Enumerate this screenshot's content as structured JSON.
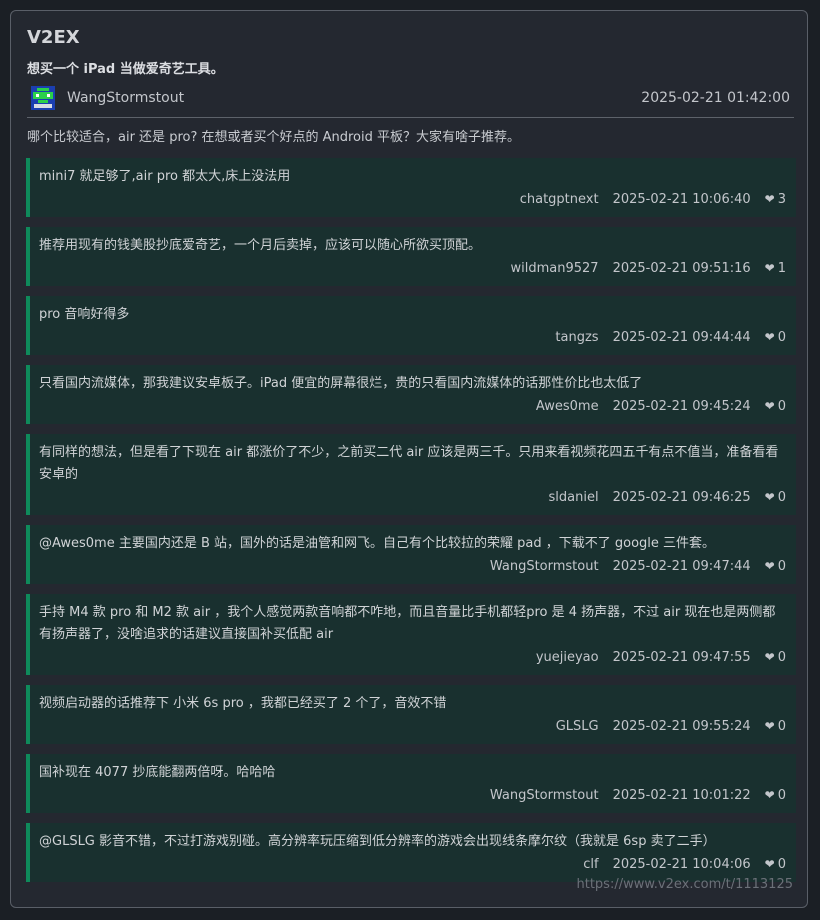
{
  "site": {
    "title": "V2EX"
  },
  "topic": {
    "title": "想买一个 iPad 当做爱奇艺工具。",
    "author": "WangStormstout",
    "time": "2025-02-21 01:42:00",
    "body": "哪个比较适合，air 还是 pro? 在想或者买个好点的 Android 平板？大家有啥子推荐。"
  },
  "replies": [
    {
      "text": "mini7 就足够了,air pro 都太大,床上没法用",
      "user": "chatgptnext",
      "time": "2025-02-21 10:06:40",
      "likes": "3"
    },
    {
      "text": "推荐用现有的钱美股抄底爱奇艺，一个月后卖掉，应该可以随心所欲买顶配。",
      "user": "wildman9527",
      "time": "2025-02-21 09:51:16",
      "likes": "1"
    },
    {
      "text": "pro 音响好得多",
      "user": "tangzs",
      "time": "2025-02-21 09:44:44",
      "likes": "0"
    },
    {
      "text": "只看国内流媒体，那我建议安卓板子。iPad 便宜的屏幕很烂，贵的只看国内流媒体的话那性价比也太低了",
      "user": "Awes0me",
      "time": "2025-02-21 09:45:24",
      "likes": "0"
    },
    {
      "text": "有同样的想法，但是看了下现在 air 都涨价了不少，之前买二代 air 应该是两三千。只用来看视频花四五千有点不值当，准备看看安卓的",
      "user": "sldaniel",
      "time": "2025-02-21 09:46:25",
      "likes": "0"
    },
    {
      "text": "@Awes0me 主要国内还是 B 站，国外的话是油管和网飞。自己有个比较拉的荣耀 pad ，下载不了 google 三件套。",
      "user": "WangStormstout",
      "time": "2025-02-21 09:47:44",
      "likes": "0"
    },
    {
      "text": "手持 M4 款 pro 和 M2 款 air ，我个人感觉两款音响都不咋地，而且音量比手机都轻pro 是 4 扬声器，不过 air 现在也是两侧都有扬声器了，没啥追求的话建议直接国补买低配 air",
      "user": "yuejieyao",
      "time": "2025-02-21 09:47:55",
      "likes": "0"
    },
    {
      "text": "视频启动器的话推荐下 小米 6s pro ，我都已经买了 2 个了，音效不错",
      "user": "GLSLG",
      "time": "2025-02-21 09:55:24",
      "likes": "0"
    },
    {
      "text": "国补现在 4077 抄底能翻两倍呀。哈哈哈",
      "user": "WangStormstout",
      "time": "2025-02-21 10:01:22",
      "likes": "0"
    },
    {
      "text": "@GLSLG 影音不错，不过打游戏别碰。高分辨率玩压缩到低分辨率的游戏会出现线条摩尔纹（我就是 6sp 卖了二手）",
      "user": "clf",
      "time": "2025-02-21 10:04:06",
      "likes": "0"
    }
  ],
  "footer": {
    "url": "https://www.v2ex.com/t/1113125"
  },
  "colors": {
    "page_bg": "#1b1f25",
    "card_bg": "#242830",
    "reply_bg": "#19302f",
    "reply_accent": "#0f8a5b"
  },
  "icons": {
    "like": "heart-icon"
  }
}
